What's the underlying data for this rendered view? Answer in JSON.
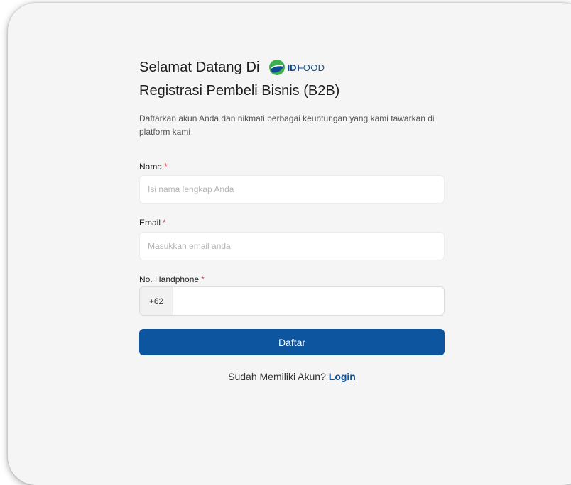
{
  "header": {
    "welcome": "Selamat Datang Di",
    "logo_id": "ID",
    "logo_food": "FOOD",
    "logo_icon": "idfood-leaf-logo"
  },
  "title": "Registrasi Pembeli Bisnis (B2B)",
  "description": "Daftarkan akun Anda dan nikmati berbagai keuntungan yang kami tawarkan di platform kami",
  "fields": {
    "name": {
      "label": "Nama",
      "required_mark": "*",
      "placeholder": "Isi nama lengkap Anda",
      "value": ""
    },
    "email": {
      "label": "Email",
      "required_mark": "*",
      "placeholder": "Masukkan email anda",
      "value": ""
    },
    "phone": {
      "label": "No. Handphone",
      "required_mark": "*",
      "prefix": "+62",
      "value": ""
    }
  },
  "submit_label": "Daftar",
  "footer": {
    "prompt": "Sudah Memiliki Akun?",
    "login_label": "Login"
  },
  "colors": {
    "primary": "#0e55a0",
    "brand_green": "#3db04b",
    "brand_blue": "#0e4c94",
    "required": "#e0393e",
    "card_background": "#f5f5f5"
  }
}
